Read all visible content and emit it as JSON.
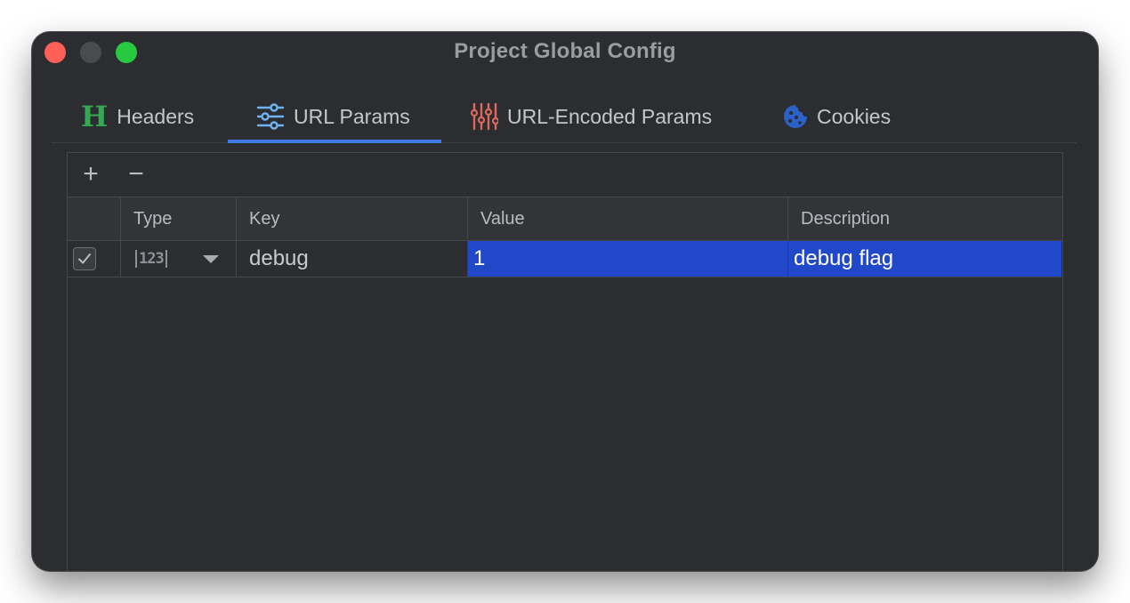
{
  "window": {
    "title": "Project Global Config"
  },
  "tabs": [
    {
      "label": "Headers",
      "icon": "headers-h-icon",
      "active": false
    },
    {
      "label": "URL Params",
      "icon": "sliders-icon",
      "active": true
    },
    {
      "label": "URL-Encoded Params",
      "icon": "vertical-sliders-icon",
      "active": false
    },
    {
      "label": "Cookies",
      "icon": "cookie-icon",
      "active": false
    }
  ],
  "toolbar": {
    "add_label": "+",
    "remove_label": "−"
  },
  "table": {
    "columns": [
      "",
      "Type",
      "Key",
      "Value",
      "Description"
    ],
    "rows": [
      {
        "enabled": true,
        "type_icon": "123",
        "key": "debug",
        "value": "1",
        "description": "debug flag"
      }
    ]
  },
  "colors": {
    "accent": "#3d7be0",
    "selection": "#2148c8",
    "headers_icon": "#34a853",
    "sliders_icon": "#6fb3f5",
    "encoded_icon": "#e0685b",
    "cookie_icon": "#2a62c9"
  }
}
